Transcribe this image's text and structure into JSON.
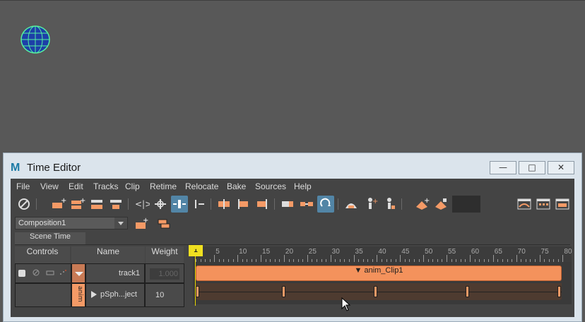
{
  "window": {
    "title": "Time Editor",
    "logo": "M"
  },
  "menu": [
    "File",
    "View",
    "Edit",
    "Tracks",
    "Clip",
    "Retime",
    "Relocate",
    "Bake",
    "Sources",
    "Help"
  ],
  "composition": "Composition1",
  "tab": "Scene Time",
  "headers": {
    "controls": "Controls",
    "name": "Name",
    "weight": "Weight"
  },
  "track": {
    "name": "track1",
    "weight": "1.000"
  },
  "clip_row": {
    "name": "pSph...ject",
    "weight": "10",
    "tag": "anim"
  },
  "clip": {
    "label": "anim_Clip1",
    "key_frames": [
      1,
      20,
      40,
      60,
      80
    ]
  },
  "playhead": {
    "frame": "1"
  },
  "ruler_labels": [
    "5",
    "10",
    "15",
    "20",
    "25",
    "30",
    "35",
    "40",
    "45",
    "50",
    "55",
    "60",
    "65",
    "70",
    "75",
    "80"
  ],
  "colors": {
    "clip": "#f4925c",
    "accent": "#5285a6",
    "playhead": "#f0e020"
  }
}
